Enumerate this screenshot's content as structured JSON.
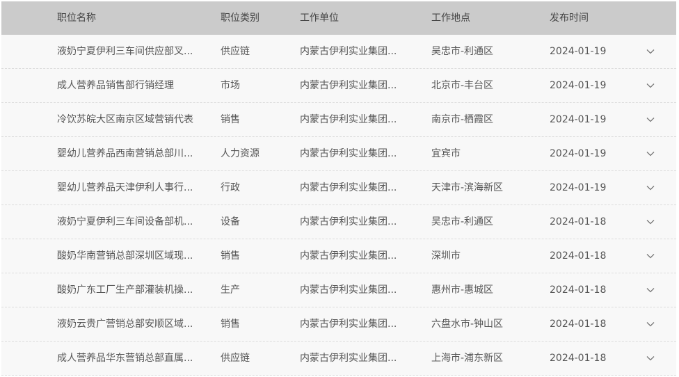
{
  "columns": {
    "title": "职位名称",
    "category": "职位类别",
    "unit": "工作单位",
    "location": "工作地点",
    "date": "发布时间"
  },
  "rows": [
    {
      "title": "液奶宁夏伊利三车间供应部叉...",
      "category": "供应链",
      "unit": "内蒙古伊利实业集团...",
      "location": "吴忠市-利通区",
      "date": "2024-01-19",
      "expand_icon": "chevron-down-icon"
    },
    {
      "title": "成人营养品销售部行销经理",
      "category": "市场",
      "unit": "内蒙古伊利实业集团...",
      "location": "北京市-丰台区",
      "date": "2024-01-19",
      "expand_icon": "chevron-down-icon"
    },
    {
      "title": "冷饮苏皖大区南京区域营销代表",
      "category": "销售",
      "unit": "内蒙古伊利实业集团...",
      "location": "南京市-栖霞区",
      "date": "2024-01-19",
      "expand_icon": "chevron-down-icon"
    },
    {
      "title": "婴幼儿营养品西南营销总部川...",
      "category": "人力资源",
      "unit": "内蒙古伊利实业集团...",
      "location": "宜宾市",
      "date": "2024-01-19",
      "expand_icon": "chevron-down-icon"
    },
    {
      "title": "婴幼儿营养品天津伊利人事行...",
      "category": "行政",
      "unit": "内蒙古伊利实业集团...",
      "location": "天津市-滨海新区",
      "date": "2024-01-19",
      "expand_icon": "chevron-down-icon"
    },
    {
      "title": "液奶宁夏伊利三车间设备部机...",
      "category": "设备",
      "unit": "内蒙古伊利实业集团...",
      "location": "吴忠市-利通区",
      "date": "2024-01-18",
      "expand_icon": "chevron-down-icon"
    },
    {
      "title": "酸奶华南营销总部深圳区域现...",
      "category": "销售",
      "unit": "内蒙古伊利实业集团...",
      "location": "深圳市",
      "date": "2024-01-18",
      "expand_icon": "chevron-down-icon"
    },
    {
      "title": "酸奶广东工厂生产部灌装机操...",
      "category": "生产",
      "unit": "内蒙古伊利实业集团...",
      "location": "惠州市-惠城区",
      "date": "2024-01-18",
      "expand_icon": "chevron-down-icon"
    },
    {
      "title": "液奶云贵广营销总部安顺区域...",
      "category": "销售",
      "unit": "内蒙古伊利实业集团...",
      "location": "六盘水市-钟山区",
      "date": "2024-01-18",
      "expand_icon": "chevron-down-icon"
    },
    {
      "title": "成人营养品华东营销总部直属...",
      "category": "供应链",
      "unit": "内蒙古伊利实业集团...",
      "location": "上海市-浦东新区",
      "date": "2024-01-18",
      "expand_icon": "chevron-down-icon"
    }
  ],
  "colors": {
    "header_bg": "#cbcbcb",
    "row_bg": "#f8f8f8",
    "text": "#555555"
  }
}
